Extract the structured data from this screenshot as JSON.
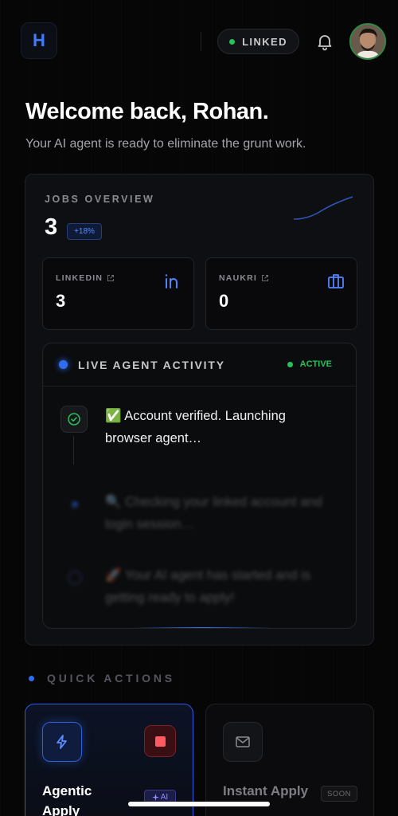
{
  "header": {
    "logo_letter": "H",
    "linked_label": "LINKED"
  },
  "welcome": {
    "title": "Welcome back, Rohan.",
    "subtitle": "Your AI agent is ready to eliminate the grunt work."
  },
  "jobs_overview": {
    "label": "JOBS OVERVIEW",
    "total": "3",
    "change_badge": "+18%",
    "sources": [
      {
        "label": "LINKEDIN",
        "value": "3",
        "icon": "linkedin-icon"
      },
      {
        "label": "NAUKRI",
        "value": "0",
        "icon": "briefcase-icon"
      }
    ]
  },
  "live_activity": {
    "title": "LIVE AGENT ACTIVITY",
    "status": "ACTIVE",
    "steps": [
      {
        "text": "✅ Account verified. Launching browser agent…",
        "icon": "check-circle-icon"
      },
      {
        "text": "🔍 Checking your linked account and login session…",
        "icon": "dot-icon"
      },
      {
        "text": "🚀 Your AI agent has started and is getting ready to apply!",
        "icon": "ring-icon"
      }
    ]
  },
  "quick_actions": {
    "label": "QUICK ACTIONS",
    "items": [
      {
        "title": "Agentic Apply",
        "badge": "AI",
        "icon": "bolt-icon",
        "action_icon": "stop-icon"
      },
      {
        "title": "Instant Apply",
        "badge": "SOON",
        "icon": "mail-icon"
      }
    ]
  },
  "colors": {
    "accent": "#2f6df0",
    "success": "#26c25b",
    "danger": "#ff5a64"
  }
}
